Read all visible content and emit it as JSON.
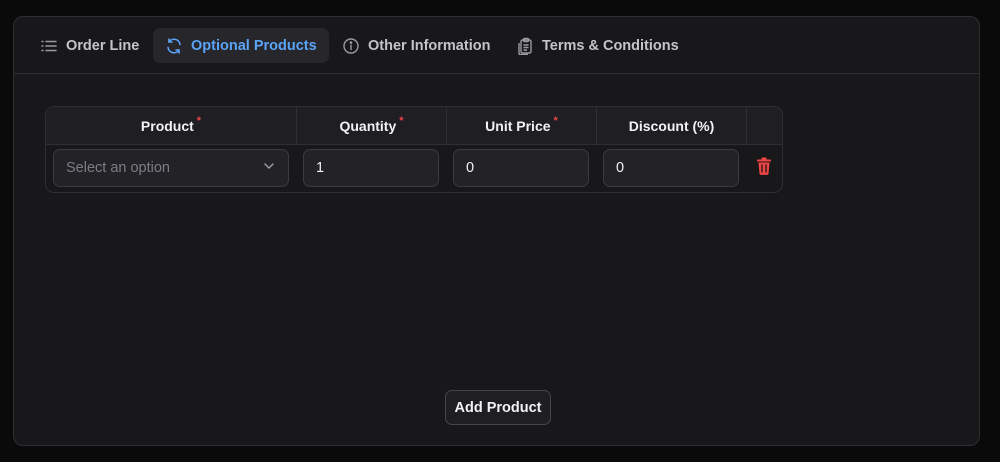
{
  "tabs": [
    {
      "label": "Order Line",
      "icon": "list-icon",
      "active": false
    },
    {
      "label": "Optional Products",
      "icon": "refresh-icon",
      "active": true
    },
    {
      "label": "Other Information",
      "icon": "info-icon",
      "active": false
    },
    {
      "label": "Terms & Conditions",
      "icon": "clipboard-icon",
      "active": false
    }
  ],
  "table": {
    "headers": [
      {
        "label": "Product",
        "required": "*"
      },
      {
        "label": "Quantity",
        "required": "*"
      },
      {
        "label": "Unit Price",
        "required": "*"
      },
      {
        "label": "Discount (%)",
        "required": ""
      }
    ],
    "row": {
      "product_placeholder": "Select an option",
      "quantity": "1",
      "unit_price": "0",
      "discount": "0"
    }
  },
  "add_product_label": "Add Product",
  "colors": {
    "accent": "#5ba4f7",
    "required": "#ef4444",
    "delete": "#ef4444",
    "panel": "#18181b"
  }
}
